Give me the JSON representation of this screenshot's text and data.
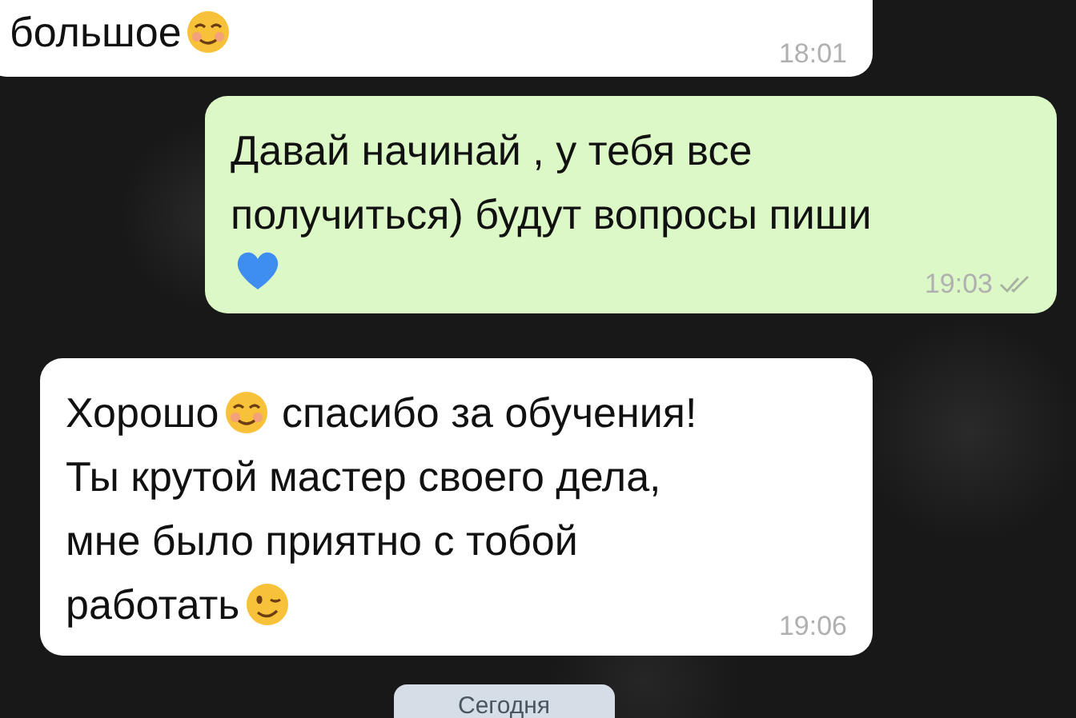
{
  "messages": [
    {
      "kind": "incoming",
      "lines": [
        [
          {
            "kind": "text",
            "text": "большое"
          },
          {
            "kind": "smile-emoji"
          }
        ]
      ],
      "time": "18:01"
    },
    {
      "kind": "outgoing",
      "lines": [
        [
          {
            "kind": "text",
            "text": "Давай начинай , у тебя все"
          }
        ],
        [
          {
            "kind": "text",
            "text": "получиться) будут вопросы пиши"
          }
        ],
        [
          {
            "kind": "heart-emoji"
          }
        ]
      ],
      "time": "19:03",
      "read": false
    },
    {
      "kind": "incoming",
      "lines": [
        [
          {
            "kind": "text",
            "text": "Хорошо"
          },
          {
            "kind": "smile-emoji"
          },
          {
            "kind": "text",
            "text": " спасибо за обучения!"
          }
        ],
        [
          {
            "kind": "text",
            "text": "Ты крутой мастер своего дела,"
          }
        ],
        [
          {
            "kind": "text",
            "text": "мне было приятно с тобой"
          }
        ],
        [
          {
            "kind": "text",
            "text": "работать"
          },
          {
            "kind": "wink-emoji"
          }
        ]
      ],
      "time": "19:06"
    }
  ],
  "date_divider": "Сегодня"
}
